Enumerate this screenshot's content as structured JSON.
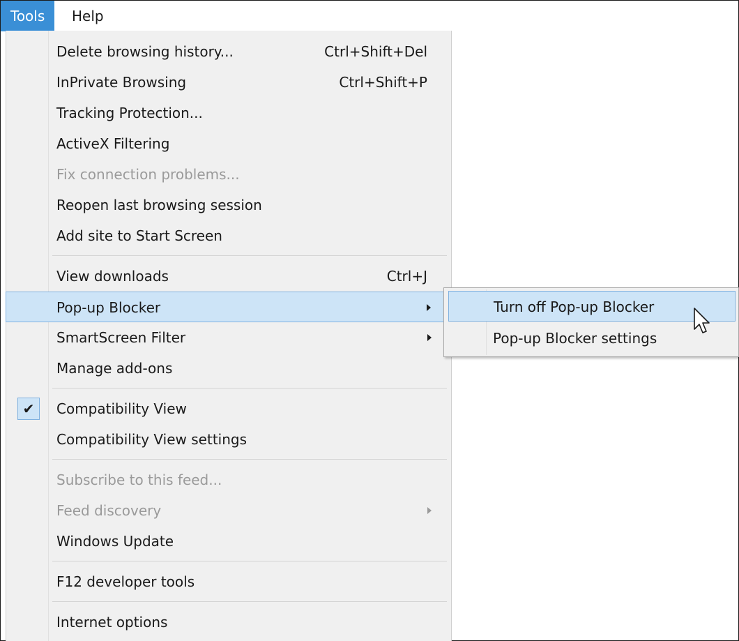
{
  "menubar": {
    "items": [
      {
        "label": "Tools",
        "active": true
      },
      {
        "label": "Help",
        "active": false
      }
    ]
  },
  "tools_menu": {
    "items": [
      {
        "label": "Delete browsing history...",
        "shortcut": "Ctrl+Shift+Del"
      },
      {
        "label": "InPrivate Browsing",
        "shortcut": "Ctrl+Shift+P"
      },
      {
        "label": "Tracking Protection..."
      },
      {
        "label": "ActiveX Filtering"
      },
      {
        "label": "Fix connection problems...",
        "disabled": true
      },
      {
        "label": "Reopen last browsing session"
      },
      {
        "label": "Add site to Start Screen"
      },
      {
        "label": "View downloads",
        "shortcut": "Ctrl+J"
      },
      {
        "label": "Pop-up Blocker",
        "submenu": true,
        "highlighted": true
      },
      {
        "label": "SmartScreen Filter",
        "submenu": true
      },
      {
        "label": "Manage add-ons"
      },
      {
        "label": "Compatibility View",
        "checked": true
      },
      {
        "label": "Compatibility View settings"
      },
      {
        "label": "Subscribe to this feed...",
        "disabled": true
      },
      {
        "label": "Feed discovery",
        "submenu": true,
        "disabled": true
      },
      {
        "label": "Windows Update"
      },
      {
        "label": "F12 developer tools"
      },
      {
        "label": "Internet options"
      }
    ],
    "check_glyph": "✔"
  },
  "popup_blocker_submenu": {
    "items": [
      {
        "label": "Turn off Pop-up Blocker",
        "highlighted": true
      },
      {
        "label": "Pop-up Blocker settings"
      }
    ]
  },
  "colors": {
    "menubar_active_bg": "#3a8fd6",
    "highlight_bg": "#cde4f7",
    "highlight_border": "#7fb1e0",
    "menu_bg": "#f0f0f0",
    "disabled_text": "#9a9a9a"
  },
  "icons": {
    "cursor": "arrow-cursor-icon",
    "submenu_arrow": "submenu-arrow-icon",
    "check": "checkmark-icon"
  }
}
